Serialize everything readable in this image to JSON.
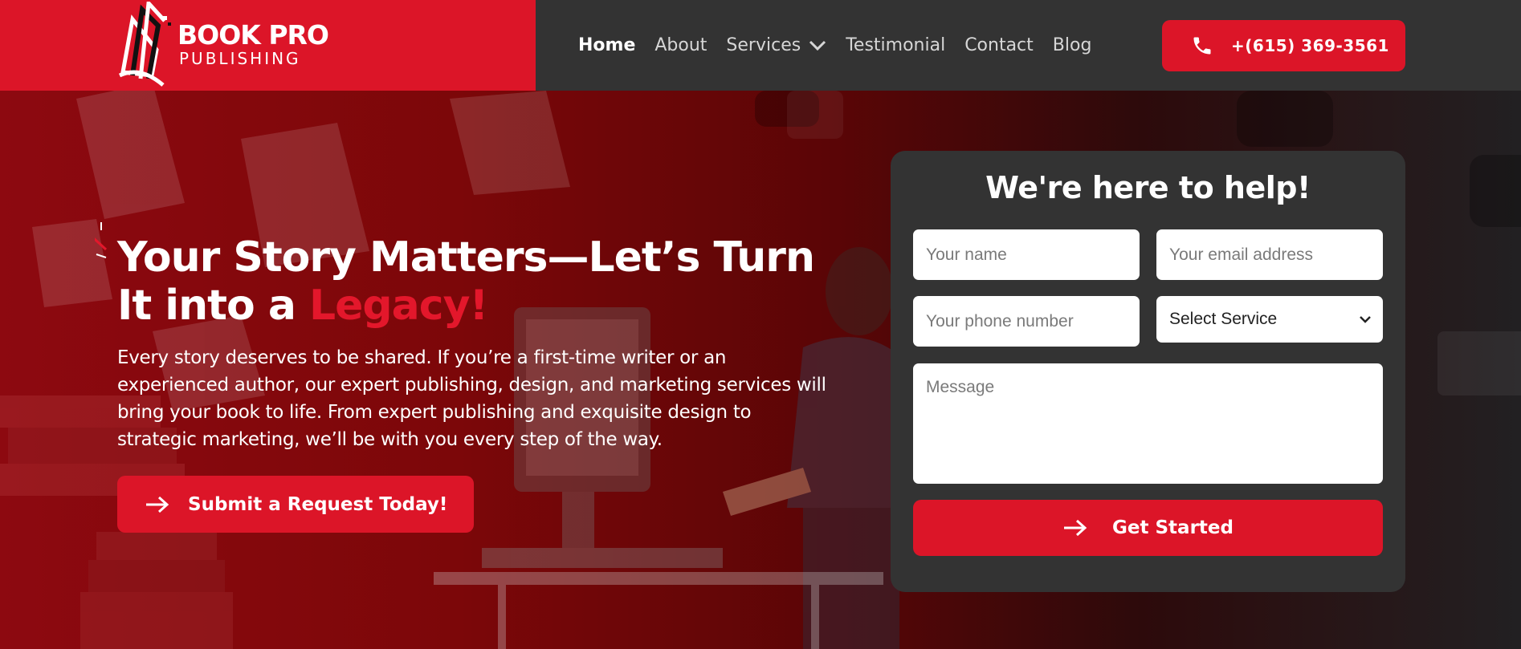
{
  "brand": {
    "name_line1": "BOOK PRO",
    "name_line2": "PUBLISHING",
    "color": "#dc1528"
  },
  "nav": {
    "items": [
      {
        "label": "Home",
        "active": true
      },
      {
        "label": "About"
      },
      {
        "label": "Services",
        "has_dropdown": true
      },
      {
        "label": "Testimonial"
      },
      {
        "label": "Contact"
      },
      {
        "label": "Blog"
      }
    ],
    "phone": "+(615) 369-3561",
    "phone_icon": "phone-icon"
  },
  "hero": {
    "title_main": "Your Story Matters—Let’s Turn It into a ",
    "title_accent": "Legacy!",
    "description": "Every story deserves to be shared. If you’re a first-time writer or an experienced author, our expert publishing, design, and marketing services will bring your book to life. From expert publishing and exquisite design to strategic marketing, we’ll be with you every step of the way.",
    "cta_label": "Submit a Request Today!",
    "cta_icon": "arrow-right-icon"
  },
  "form": {
    "title": "We're here to help!",
    "name_placeholder": "Your name",
    "email_placeholder": "Your email address",
    "phone_placeholder": "Your phone number",
    "service_selected": "Select Service",
    "message_placeholder": "Message",
    "submit_label": "Get Started"
  },
  "colors": {
    "accent": "#dc1528",
    "header_bg": "#333333",
    "card_bg": "#333333"
  }
}
